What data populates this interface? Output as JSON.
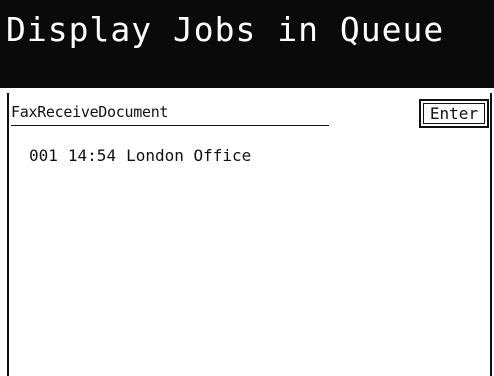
{
  "header": {
    "title": "Display Jobs in Queue"
  },
  "panel": {
    "document_type": "FaxReceiveDocument",
    "enter_label": "Enter"
  },
  "jobs": [
    {
      "number": "001",
      "time": "14:54",
      "destination": "London Office"
    }
  ]
}
